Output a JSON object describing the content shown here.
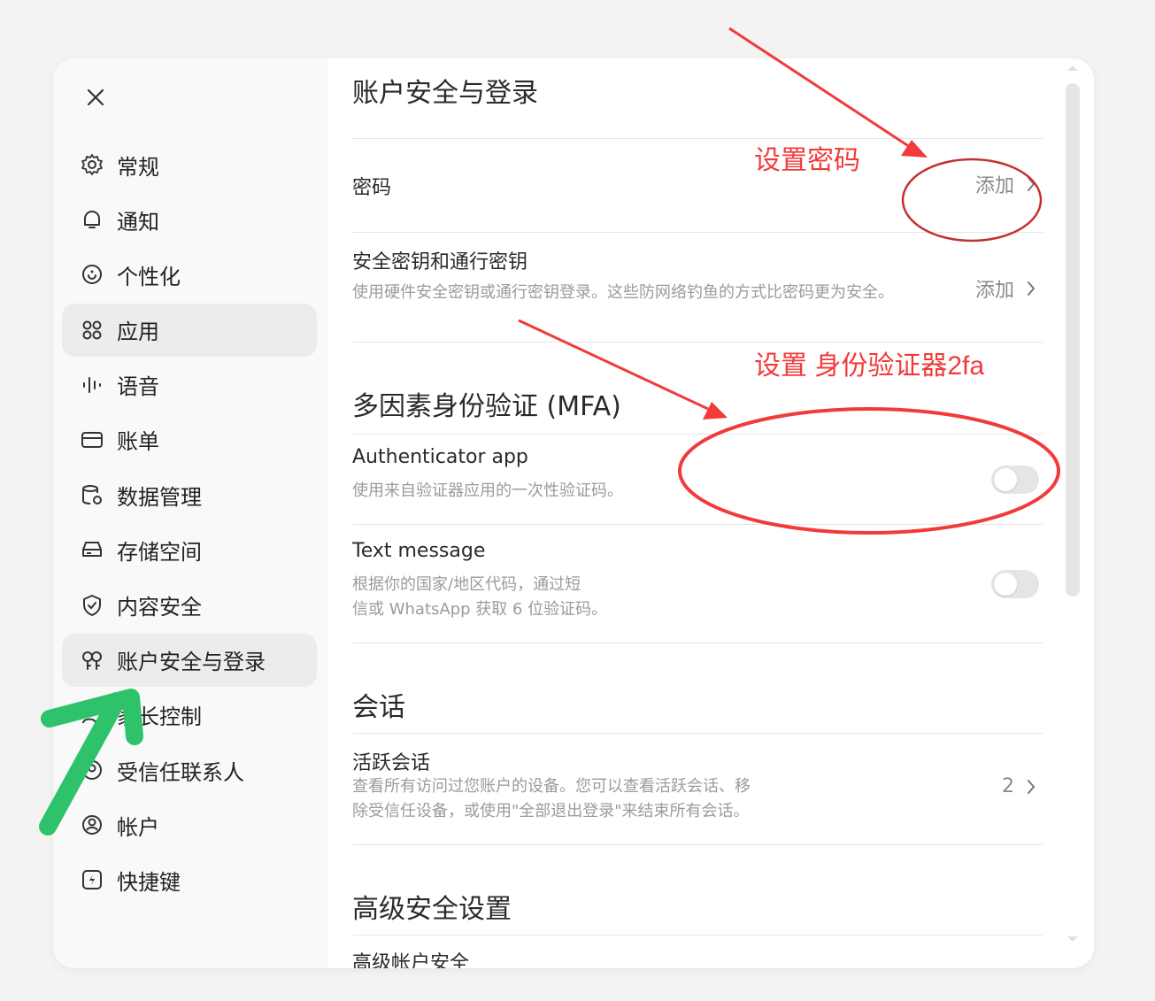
{
  "sidebar": {
    "items": [
      {
        "label": "常规",
        "icon": "gear-icon"
      },
      {
        "label": "通知",
        "icon": "bell-icon"
      },
      {
        "label": "个性化",
        "icon": "personalize-icon"
      },
      {
        "label": "应用",
        "icon": "apps-grid-icon",
        "active": true
      },
      {
        "label": "语音",
        "icon": "voice-wave-icon"
      },
      {
        "label": "账单",
        "icon": "card-icon"
      },
      {
        "label": "数据管理",
        "icon": "database-icon"
      },
      {
        "label": "存储空间",
        "icon": "storage-icon"
      },
      {
        "label": "内容安全",
        "icon": "shield-icon"
      },
      {
        "label": "账户安全与登录",
        "icon": "key-icon",
        "active": true
      },
      {
        "label": "家长控制",
        "icon": "family-icon"
      },
      {
        "label": "受信任联系人",
        "icon": "contacts-icon"
      },
      {
        "label": "帐户",
        "icon": "account-icon"
      },
      {
        "label": "快捷键",
        "icon": "shortcut-icon"
      }
    ]
  },
  "main": {
    "title": "账户安全与登录",
    "password": {
      "title": "密码",
      "action": "添加"
    },
    "passkey": {
      "title": "安全密钥和通行密钥",
      "desc": "使用硬件安全密钥或通行密钥登录。这些防网络钓鱼的方式比密码更为安全。",
      "action": "添加"
    },
    "mfa": {
      "title": "多因素身份验证 (MFA)",
      "authenticator": {
        "title": "Authenticator app",
        "desc": "使用来自验证器应用的一次性验证码。",
        "enabled": false
      },
      "sms": {
        "title": "Text message",
        "desc_line1": "根据你的国家/地区代码，通过短",
        "desc_line2": "信或 WhatsApp 获取 6 位验证码。",
        "enabled": false
      }
    },
    "sessions": {
      "title": "会话",
      "active": {
        "title": "活跃会话",
        "desc_line1": "查看所有访问过您账户的设备。您可以查看活跃会话、移",
        "desc_line2": "除受信任设备，或使用\"全部退出登录\"来结束所有会话。",
        "count": "2"
      }
    },
    "advanced": {
      "title": "高级安全设置",
      "item": "高级帐户安全"
    }
  },
  "annotations": {
    "password_note": "设置密码",
    "mfa_note": "设置 身份验证器2fa",
    "color": "#f23a3a",
    "arrow_green": "#2ec36a"
  }
}
